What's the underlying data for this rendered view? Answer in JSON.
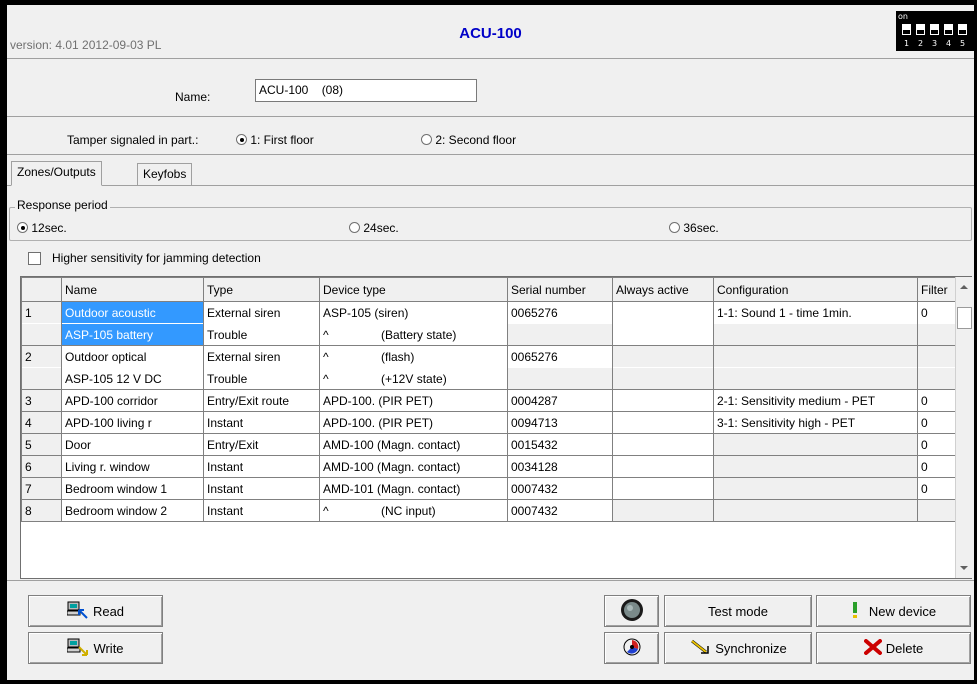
{
  "header": {
    "title": "ACU-100",
    "version": "version: 4.01 2012-09-03 PL",
    "dip_on": "on",
    "dip_numbers": [
      "1",
      "2",
      "3",
      "4",
      "5"
    ]
  },
  "name_row": {
    "label": "Name:",
    "value": "ACU-100    (08)"
  },
  "tamper": {
    "label": "Tamper signaled in part.:",
    "options": [
      "1: First floor",
      "2: Second floor"
    ],
    "selected": "1: First floor"
  },
  "tabs": [
    "Zones/Outputs",
    "Keyfobs"
  ],
  "response_period": {
    "legend": "Response period",
    "options": [
      "12sec.",
      "24sec.",
      "36sec."
    ],
    "selected": "12sec."
  },
  "jamming": {
    "label": "Higher sensitivity for jamming detection",
    "checked": false
  },
  "table": {
    "headers": [
      "",
      "Name",
      "Type",
      "Device type",
      "Serial number",
      "Always active",
      "Configuration",
      "Filter"
    ],
    "rows": [
      {
        "num": "1",
        "name": "Outdoor acoustic",
        "type": "External siren",
        "device": "ASP-105 (siren)",
        "serial": "0065276",
        "config": "1-1: Sound 1 - time 1min.",
        "filter": "0",
        "sub": {
          "name": "ASP-105 battery",
          "type": "Trouble",
          "caret": "^",
          "device": "(Battery state)"
        }
      },
      {
        "num": "2",
        "name": "Outdoor optical",
        "type": "External siren",
        "caret": "^",
        "device": "(flash)",
        "serial": "0065276",
        "config": "",
        "filter": "",
        "sub": {
          "name": "ASP-105 12 V DC",
          "type": "Trouble",
          "caret": "^",
          "device": "(+12V state)"
        }
      },
      {
        "num": "3",
        "name": "APD-100 corridor",
        "type": "Entry/Exit route",
        "device": "APD-100. (PIR PET)",
        "serial": "0004287",
        "config": "2-1: Sensitivity medium - PET",
        "filter": "0"
      },
      {
        "num": "4",
        "name": "APD-100 living r",
        "type": "Instant",
        "device": "APD-100. (PIR PET)",
        "serial": "0094713",
        "config": "3-1: Sensitivity high - PET",
        "filter": "0"
      },
      {
        "num": "5",
        "name": "Door",
        "type": "Entry/Exit",
        "device": "AMD-100 (Magn. contact)",
        "serial": "0015432",
        "config": "",
        "filter": "0"
      },
      {
        "num": "6",
        "name": "Living r. window",
        "type": "Instant",
        "device": "AMD-100 (Magn. contact)",
        "serial": "0034128",
        "config": "",
        "filter": "0"
      },
      {
        "num": "7",
        "name": "Bedroom window 1",
        "type": "Instant",
        "device": "AMD-101 (Magn. contact)",
        "serial": "0007432",
        "config": "",
        "filter": "0"
      },
      {
        "num": "8",
        "name": "Bedroom window 2",
        "type": "Instant",
        "caret": "^",
        "device": "(NC input)",
        "serial": "0007432",
        "config": "",
        "filter": ""
      }
    ]
  },
  "buttons": {
    "read": "Read",
    "write": "Write",
    "test_mode": "Test mode",
    "synchronize": "Synchronize",
    "new_device": "New device",
    "delete": "Delete"
  },
  "colors": {
    "title": "#0000c8",
    "selection": "#3399ff",
    "new_device_icon": "#2a9f2a",
    "delete_icon": "#cc0000"
  }
}
